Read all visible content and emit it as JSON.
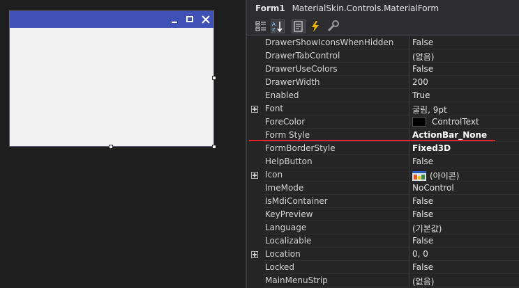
{
  "selector": {
    "name": "Form1",
    "type": "MaterialSkin.Controls.MaterialForm"
  },
  "colors": {
    "accent": "#3f51b5",
    "highlight_line": "#e0242e",
    "fore_color_swatch": "#000000"
  },
  "toolbar": {
    "buttons": [
      {
        "icon": "categorized-icon"
      },
      {
        "icon": "alphabetical-icon"
      },
      {
        "icon": "properties-icon"
      },
      {
        "icon": "events-icon"
      },
      {
        "icon": "property-pages-icon"
      }
    ]
  },
  "properties": [
    {
      "name": "DrawerShowIconsWhenHidden",
      "value": "False"
    },
    {
      "name": "DrawerTabControl",
      "value": "(없음)"
    },
    {
      "name": "DrawerUseColors",
      "value": "False"
    },
    {
      "name": "DrawerWidth",
      "value": "200"
    },
    {
      "name": "Enabled",
      "value": "True"
    },
    {
      "name": "Font",
      "value": "굴림, 9pt",
      "expandable": true
    },
    {
      "name": "ForeColor",
      "value": "ControlText",
      "swatch": true
    },
    {
      "name": "Form Style",
      "value": "ActionBar_None",
      "bold": true
    },
    {
      "name": "FormBorderStyle",
      "value": "Fixed3D",
      "bold": true
    },
    {
      "name": "HelpButton",
      "value": "False"
    },
    {
      "name": "Icon",
      "value": "(아이콘)",
      "expandable": true,
      "icon": true
    },
    {
      "name": "ImeMode",
      "value": "NoControl"
    },
    {
      "name": "IsMdiContainer",
      "value": "False"
    },
    {
      "name": "KeyPreview",
      "value": "False"
    },
    {
      "name": "Language",
      "value": "(기본값)"
    },
    {
      "name": "Localizable",
      "value": "False"
    },
    {
      "name": "Location",
      "value": "0, 0",
      "expandable": true
    },
    {
      "name": "Locked",
      "value": "False"
    },
    {
      "name": "MainMenuStrip",
      "value": "(없음)"
    }
  ]
}
